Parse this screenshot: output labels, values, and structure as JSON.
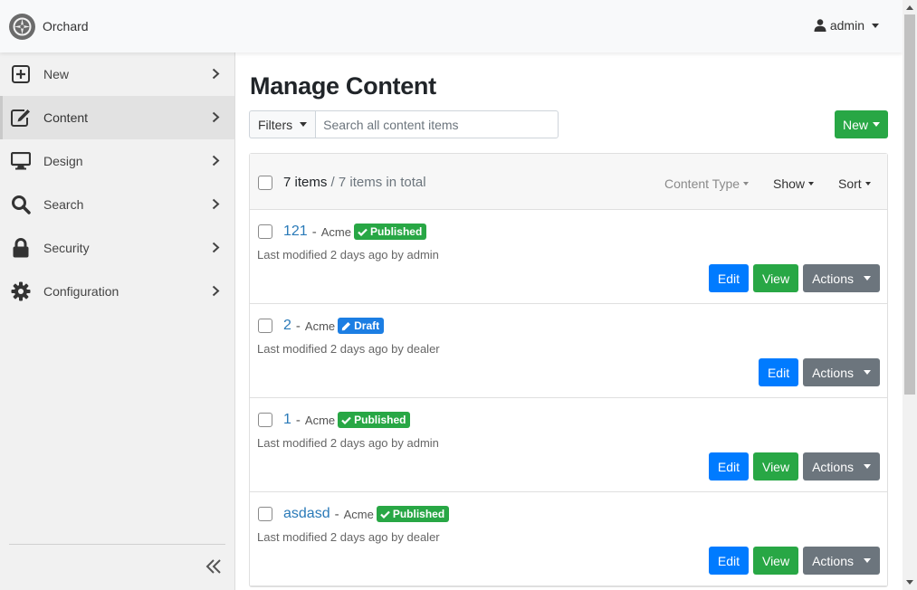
{
  "brand": {
    "name": "Orchard"
  },
  "user": {
    "name": "admin"
  },
  "sidebar": {
    "items": [
      {
        "label": "New",
        "icon": "plus-square-icon"
      },
      {
        "label": "Content",
        "icon": "edit-icon",
        "active": true
      },
      {
        "label": "Design",
        "icon": "monitor-icon"
      },
      {
        "label": "Search",
        "icon": "search-icon"
      },
      {
        "label": "Security",
        "icon": "lock-icon"
      },
      {
        "label": "Configuration",
        "icon": "gear-icon"
      }
    ]
  },
  "main": {
    "title": "Manage Content",
    "filters_label": "Filters",
    "search_placeholder": "Search all content items",
    "new_label": "New",
    "header": {
      "count": "7 items",
      "total": " / 7 items in total",
      "content_type_label": "Content Type",
      "show_label": "Show",
      "sort_label": "Sort"
    },
    "items": [
      {
        "title": "121",
        "sep": "-",
        "owner": "Acme",
        "status": "Published",
        "meta": "Last modified 2 days ago by admin",
        "has_view": true
      },
      {
        "title": "2",
        "sep": "-",
        "owner": "Acme",
        "status": "Draft",
        "meta": "Last modified 2 days ago by dealer",
        "has_view": false
      },
      {
        "title": "1",
        "sep": "-",
        "owner": "Acme",
        "status": "Published",
        "meta": "Last modified 2 days ago by admin",
        "has_view": true
      },
      {
        "title": "asdasd",
        "sep": "-",
        "owner": "Acme",
        "status": "Published",
        "meta": "Last modified 2 days ago by dealer",
        "has_view": true
      }
    ],
    "edit_label": "Edit",
    "view_label": "View",
    "actions_label": "Actions"
  },
  "colors": {
    "primary": "#007bff",
    "success": "#28a745",
    "secondary": "#6c757d",
    "link": "#2a7ab8"
  }
}
